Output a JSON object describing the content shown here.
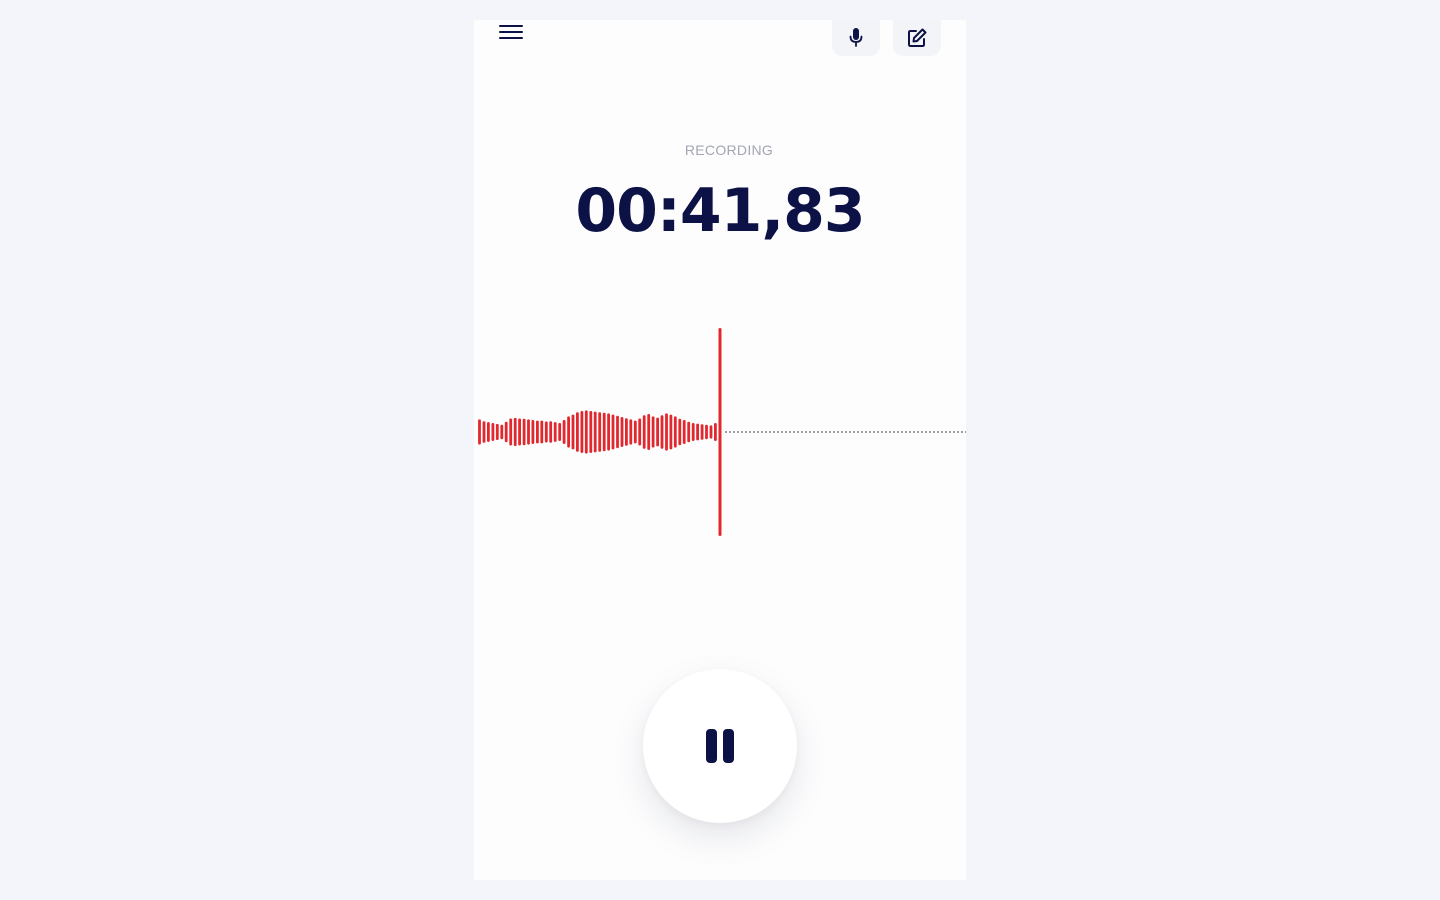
{
  "header": {
    "menu_icon": "hamburger-menu-icon",
    "mic_icon": "microphone-icon",
    "edit_icon": "edit-note-icon"
  },
  "recording": {
    "status": "RECORDING",
    "elapsed": "00:41,83"
  },
  "waveform": {
    "icon": "audio-waveform",
    "recorded_fraction": 0.5,
    "bar_amplitudes": [
      0.42,
      0.36,
      0.33,
      0.3,
      0.27,
      0.24,
      0.34,
      0.45,
      0.47,
      0.45,
      0.44,
      0.42,
      0.4,
      0.38,
      0.38,
      0.35,
      0.36,
      0.33,
      0.3,
      0.4,
      0.52,
      0.58,
      0.66,
      0.7,
      0.72,
      0.7,
      0.68,
      0.66,
      0.64,
      0.62,
      0.58,
      0.54,
      0.5,
      0.46,
      0.42,
      0.38,
      0.45,
      0.56,
      0.6,
      0.52,
      0.48,
      0.56,
      0.62,
      0.58,
      0.52,
      0.44,
      0.4,
      0.34,
      0.3,
      0.28,
      0.26,
      0.24,
      0.22,
      0.3
    ],
    "colors": {
      "bars": "#e0282e",
      "playhead": "#e0282e",
      "pending_line": "#9a9ca6"
    }
  },
  "controls": {
    "pause_icon": "pause-icon"
  },
  "colors": {
    "accent": "#e0282e",
    "text_primary": "#0c1245",
    "text_muted": "#a3a6b2",
    "background": "#f3f5fa",
    "panel": "#fdfdfe"
  }
}
